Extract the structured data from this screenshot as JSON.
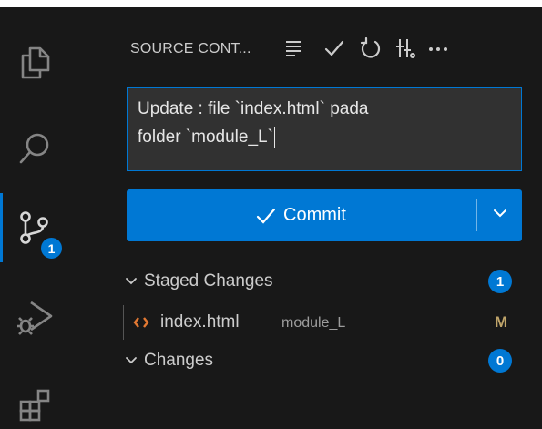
{
  "activity_bar": {
    "items": [
      {
        "icon": "explorer-icon"
      },
      {
        "icon": "search-icon"
      },
      {
        "icon": "source-control-icon",
        "active": true,
        "badge": "1"
      },
      {
        "icon": "run-debug-icon"
      },
      {
        "icon": "extensions-icon"
      }
    ],
    "accent_color": "#0078d4"
  },
  "sidebar": {
    "header": {
      "title": "SOURCE CONT...",
      "actions": [
        "view-as-tree-icon",
        "commit-check-icon",
        "refresh-icon",
        "branch-graph-icon",
        "more-actions-icon"
      ]
    },
    "commit_message": {
      "line1": "Update : file `index.html` pada",
      "line2": "folder `module_L`"
    },
    "commit_button": {
      "label": "Commit"
    },
    "staged": {
      "label": "Staged Changes",
      "count": "1",
      "files": [
        {
          "name": "index.html",
          "folder": "module_L",
          "status": "M"
        }
      ]
    },
    "changes": {
      "label": "Changes",
      "count": "0"
    }
  },
  "colors": {
    "background": "#181818",
    "input_background": "#313131",
    "accent": "#0078d4",
    "modified": "#c0a56a",
    "html_file_icon": "#e37933"
  }
}
